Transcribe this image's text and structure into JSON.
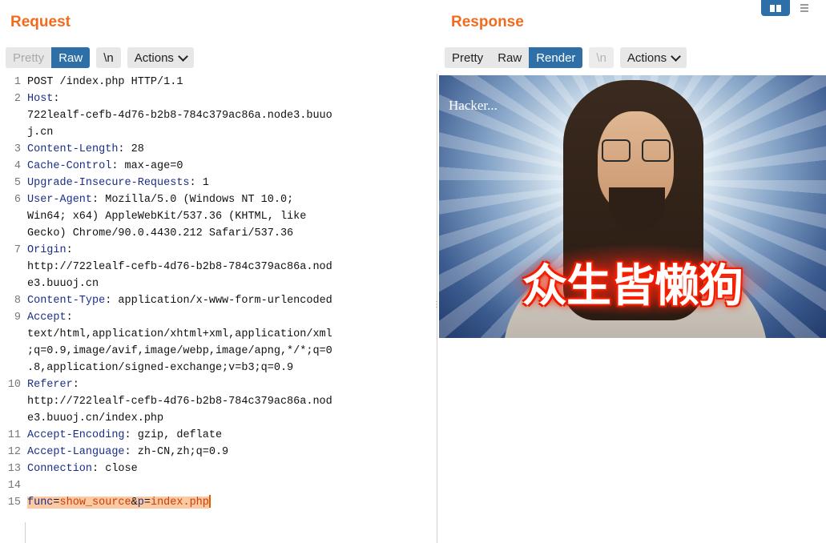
{
  "request": {
    "title": "Request",
    "toolbar": {
      "pretty": "Pretty",
      "raw": "Raw",
      "newline": "\\n",
      "actions": "Actions"
    },
    "lines": [
      {
        "n": "1",
        "key": "",
        "sep": "",
        "val": "POST /index.php HTTP/1.1"
      },
      {
        "n": "2",
        "key": "Host",
        "sep": ":",
        "val": ""
      },
      {
        "n": "",
        "key": "",
        "sep": "",
        "val": "722lealf-cefb-4d76-b2b8-784c379ac86a.node3.buuo"
      },
      {
        "n": "",
        "key": "",
        "sep": "",
        "val": "j.cn"
      },
      {
        "n": "3",
        "key": "Content-Length",
        "sep": ":",
        "val": " 28"
      },
      {
        "n": "4",
        "key": "Cache-Control",
        "sep": ":",
        "val": " max-age=0"
      },
      {
        "n": "5",
        "key": "Upgrade-Insecure-Requests",
        "sep": ":",
        "val": " 1"
      },
      {
        "n": "6",
        "key": "User-Agent",
        "sep": ":",
        "val": " Mozilla/5.0 (Windows NT 10.0;"
      },
      {
        "n": "",
        "key": "",
        "sep": "",
        "val": "Win64; x64) AppleWebKit/537.36 (KHTML, like"
      },
      {
        "n": "",
        "key": "",
        "sep": "",
        "val": "Gecko) Chrome/90.0.4430.212 Safari/537.36"
      },
      {
        "n": "7",
        "key": "Origin",
        "sep": ":",
        "val": ""
      },
      {
        "n": "",
        "key": "",
        "sep": "",
        "val": "http://722lealf-cefb-4d76-b2b8-784c379ac86a.nod"
      },
      {
        "n": "",
        "key": "",
        "sep": "",
        "val": "e3.buuoj.cn"
      },
      {
        "n": "8",
        "key": "Content-Type",
        "sep": ":",
        "val": " application/x-www-form-urlencoded"
      },
      {
        "n": "9",
        "key": "Accept",
        "sep": ":",
        "val": ""
      },
      {
        "n": "",
        "key": "",
        "sep": "",
        "val": "text/html,application/xhtml+xml,application/xml"
      },
      {
        "n": "",
        "key": "",
        "sep": "",
        "val": ";q=0.9,image/avif,image/webp,image/apng,*/*;q=0"
      },
      {
        "n": "",
        "key": "",
        "sep": "",
        "val": ".8,application/signed-exchange;v=b3;q=0.9"
      },
      {
        "n": "10",
        "key": "Referer",
        "sep": ":",
        "val": ""
      },
      {
        "n": "",
        "key": "",
        "sep": "",
        "val": "http://722lealf-cefb-4d76-b2b8-784c379ac86a.nod"
      },
      {
        "n": "",
        "key": "",
        "sep": "",
        "val": "e3.buuoj.cn/index.php"
      },
      {
        "n": "11",
        "key": "Accept-Encoding",
        "sep": ":",
        "val": " gzip, deflate"
      },
      {
        "n": "12",
        "key": "Accept-Language",
        "sep": ":",
        "val": " zh-CN,zh;q=0.9"
      },
      {
        "n": "13",
        "key": "Connection",
        "sep": ":",
        "val": " close"
      },
      {
        "n": "14",
        "key": "",
        "sep": "",
        "val": ""
      }
    ],
    "body_line": {
      "n": "15",
      "k1": "func",
      "v1": "show_source",
      "k2": "p",
      "v2": "index.php"
    }
  },
  "response": {
    "title": "Response",
    "toolbar": {
      "pretty": "Pretty",
      "raw": "Raw",
      "render": "Render",
      "newline": "\\n",
      "actions": "Actions"
    },
    "render": {
      "hacker_text": "Hacker...",
      "meme_caption": "众生皆懒狗"
    }
  },
  "colors": {
    "accent": "#f26b1d",
    "active_tab": "#2e6fa7",
    "header_key": "#1a2f85",
    "param_value": "#c2410c",
    "highlight": "#fdc9a3"
  }
}
